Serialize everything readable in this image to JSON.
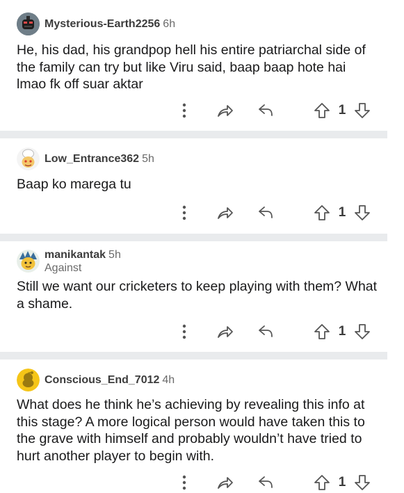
{
  "comments": [
    {
      "username": "Mysterious-Earth2256",
      "time": "6h",
      "flair": "",
      "body": "He, his dad, his grandpop hell his entire patriarchal side of the family can try but like Viru said, baap baap hote hai lmao fk off suar aktar",
      "votes": "1",
      "avatar_icon": "dark-robot-avatar-icon"
    },
    {
      "username": "Low_Entrance362",
      "time": "5h",
      "flair": "",
      "body": "Baap ko marega tu",
      "votes": "1",
      "avatar_icon": "chef-snoo-avatar-icon"
    },
    {
      "username": "manikantak",
      "time": "5h",
      "flair": "Against",
      "body": "Still we want our cricketers to keep playing with them? What a shame.",
      "votes": "1",
      "avatar_icon": "yellow-haired-snoo-avatar-icon"
    },
    {
      "username": "Conscious_End_7012",
      "time": "4h",
      "flair": "",
      "body": "What does he think he’s achieving by revealing this info at this stage? A more logical person would have taken this to the grave with himself and probably wouldn’t have tried to hurt another player to begin with.",
      "votes": "1",
      "avatar_icon": "yellow-default-snoo-avatar-icon"
    }
  ],
  "icons": {
    "more": "more-options-icon",
    "share": "share-icon",
    "reply": "reply-icon",
    "upvote": "upvote-icon",
    "downvote": "downvote-icon"
  },
  "colors": {
    "divider": "#e9ebed",
    "icon": "#555555",
    "username": "#3c3c3c",
    "meta": "#6a6a6a"
  }
}
